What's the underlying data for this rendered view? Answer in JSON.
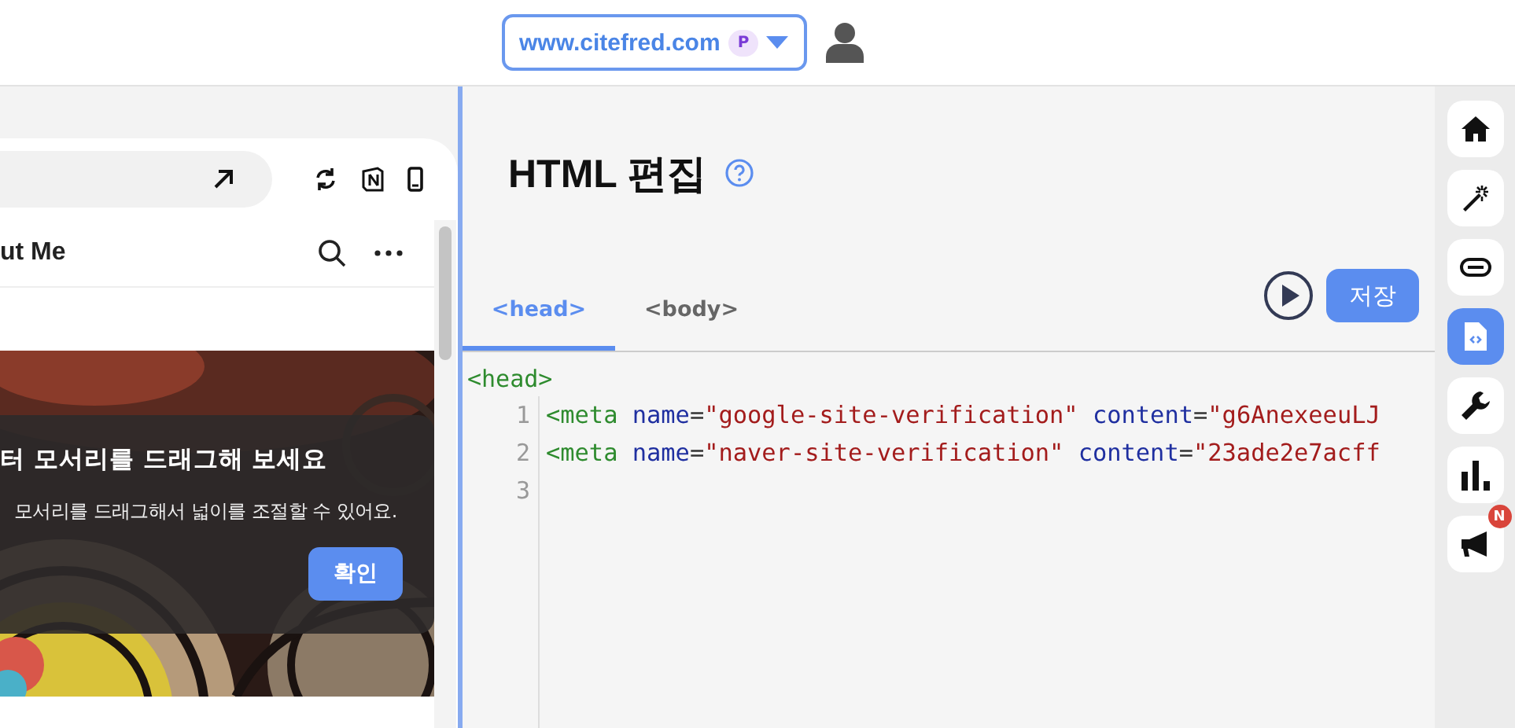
{
  "top_bar": {
    "site": "www.citefred.com",
    "plan_badge": "P"
  },
  "preview": {
    "page_title": "ut Me",
    "tooltip": {
      "title": "터 모서리를 드래그해 보세요",
      "text": "모서리를 드래그해서 넓이를 조절할 수 있어요.",
      "button": "확인"
    }
  },
  "editor": {
    "title": "HTML 편집",
    "tabs": [
      {
        "label": "<head>",
        "selected": true
      },
      {
        "label": "<body>",
        "selected": false
      }
    ],
    "save_button": "저장",
    "section_tag": "<head>",
    "lines": [
      {
        "number": "1",
        "tokens": [
          {
            "kind": "tag",
            "text": "<meta"
          },
          {
            "kind": "attr",
            "text": " name"
          },
          {
            "kind": "punct",
            "text": "="
          },
          {
            "kind": "value",
            "text": "\"google-site-verification\""
          },
          {
            "kind": "attr",
            "text": " content"
          },
          {
            "kind": "punct",
            "text": "="
          },
          {
            "kind": "value",
            "text": "\"g6AnexeeuLJ"
          }
        ]
      },
      {
        "number": "2",
        "tokens": [
          {
            "kind": "tag",
            "text": "<meta"
          },
          {
            "kind": "attr",
            "text": " name"
          },
          {
            "kind": "punct",
            "text": "="
          },
          {
            "kind": "value",
            "text": "\"naver-site-verification\""
          },
          {
            "kind": "attr",
            "text": " content"
          },
          {
            "kind": "punct",
            "text": "="
          },
          {
            "kind": "value",
            "text": "\"23ade2e7acff"
          }
        ]
      },
      {
        "number": "3"
      }
    ]
  },
  "sidebar": {
    "items": [
      {
        "selected": false
      },
      {
        "selected": false
      },
      {
        "selected": false
      },
      {
        "selected": true
      },
      {
        "selected": false
      },
      {
        "selected": false
      },
      {
        "selected": false,
        "badge": "N"
      }
    ]
  }
}
